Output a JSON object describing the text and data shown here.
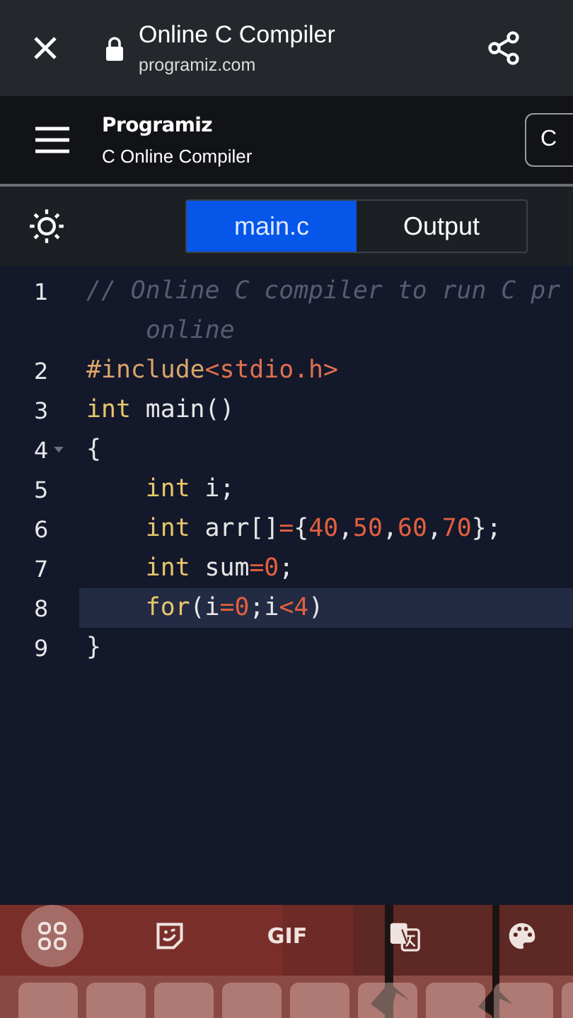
{
  "browser_bar": {
    "title": "Online C Compiler",
    "url": "programiz.com"
  },
  "header": {
    "logo": "Programiz",
    "subtitle": "C Online Compiler",
    "button_label": "C"
  },
  "tabs": [
    {
      "label": "main.c",
      "selected": true
    },
    {
      "label": "Output",
      "selected": false
    }
  ],
  "editor": {
    "lines": [
      {
        "number": "1",
        "fold": false,
        "active": false,
        "tokens": [
          {
            "text": "// Online C compiler to run C pr",
            "kind": "comment"
          }
        ],
        "wrap": "online"
      },
      {
        "number": "2",
        "fold": false,
        "active": false,
        "tokens": [
          {
            "text": "#include",
            "kind": "preproc"
          },
          {
            "text": "<stdio.h>",
            "kind": "string"
          }
        ]
      },
      {
        "number": "3",
        "fold": false,
        "active": false,
        "tokens": [
          {
            "text": "int",
            "kind": "keyword"
          },
          {
            "text": " main()",
            "kind": "plain"
          }
        ]
      },
      {
        "number": "4",
        "fold": true,
        "active": false,
        "tokens": [
          {
            "text": "{",
            "kind": "plain"
          }
        ]
      },
      {
        "number": "5",
        "fold": false,
        "active": false,
        "tokens": [
          {
            "text": "    int",
            "kind": "keyword"
          },
          {
            "text": " i;",
            "kind": "plain"
          }
        ]
      },
      {
        "number": "6",
        "fold": false,
        "active": false,
        "tokens": [
          {
            "text": "    int",
            "kind": "keyword"
          },
          {
            "text": " arr[]",
            "kind": "plain"
          },
          {
            "text": "=",
            "kind": "operator"
          },
          {
            "text": "{",
            "kind": "plain"
          },
          {
            "text": "40",
            "kind": "number"
          },
          {
            "text": ",",
            "kind": "plain"
          },
          {
            "text": "50",
            "kind": "number"
          },
          {
            "text": ",",
            "kind": "plain"
          },
          {
            "text": "60",
            "kind": "number"
          },
          {
            "text": ",",
            "kind": "plain"
          },
          {
            "text": "70",
            "kind": "number"
          },
          {
            "text": "};",
            "kind": "plain"
          }
        ]
      },
      {
        "number": "7",
        "fold": false,
        "active": false,
        "tokens": [
          {
            "text": "    int",
            "kind": "keyword"
          },
          {
            "text": " sum",
            "kind": "plain"
          },
          {
            "text": "=",
            "kind": "operator"
          },
          {
            "text": "0",
            "kind": "number"
          },
          {
            "text": ";",
            "kind": "plain"
          }
        ]
      },
      {
        "number": "8",
        "fold": false,
        "active": true,
        "tokens": [
          {
            "text": "    for",
            "kind": "keyword"
          },
          {
            "text": "(",
            "kind": "plain"
          },
          {
            "text": "i",
            "kind": "plain"
          },
          {
            "text": "=",
            "kind": "operator"
          },
          {
            "text": "0",
            "kind": "number"
          },
          {
            "text": ";i",
            "kind": "plain"
          },
          {
            "text": "<",
            "kind": "operator"
          },
          {
            "text": "4",
            "kind": "number"
          },
          {
            "text": ")",
            "kind": "plain"
          }
        ]
      },
      {
        "number": "9",
        "fold": false,
        "active": false,
        "tokens": [
          {
            "text": "}",
            "kind": "plain"
          }
        ]
      }
    ]
  },
  "keyboard_toolbar": [
    {
      "kind": "apps",
      "selected": true
    },
    {
      "kind": "sticker",
      "selected": false
    },
    {
      "kind": "text",
      "label": "GIF",
      "selected": false
    },
    {
      "kind": "translate",
      "selected": false
    },
    {
      "kind": "palette",
      "selected": false
    }
  ]
}
